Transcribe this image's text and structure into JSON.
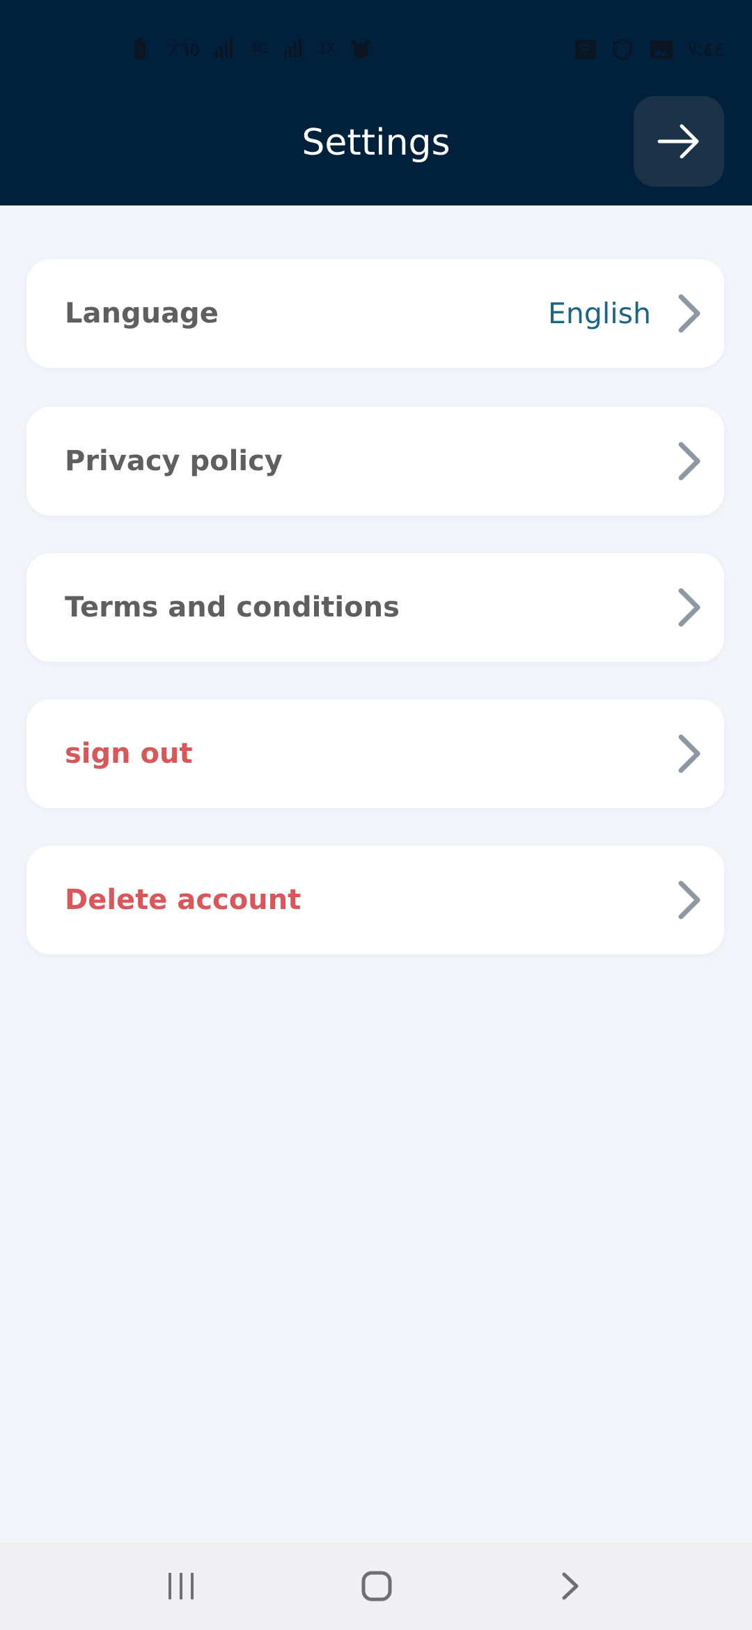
{
  "status_bar": {
    "left_text": "٪٦٥",
    "network_label": "4G",
    "speed_label": "1X",
    "time": "٧:٤٤"
  },
  "header": {
    "title": "Settings",
    "back_icon": "arrow-right-icon"
  },
  "settings": {
    "items": [
      {
        "label": "Language",
        "value": "English",
        "style": "normal",
        "icon": "chevron-right-icon"
      },
      {
        "label": "Privacy policy",
        "style": "normal",
        "icon": "chevron-right-icon"
      },
      {
        "label": "Terms and conditions",
        "style": "normal",
        "icon": "chevron-right-icon"
      },
      {
        "label": "sign out",
        "style": "danger",
        "icon": "chevron-right-icon"
      },
      {
        "label": "Delete account",
        "style": "danger",
        "icon": "chevron-right-icon"
      }
    ]
  },
  "navbar": {
    "icons": [
      "recent-apps-icon",
      "home-icon",
      "back-icon"
    ]
  },
  "colors": {
    "header_bg": "#00203c",
    "page_bg": "#f3f5fa",
    "danger": "#d9575a",
    "accent": "#1d6584",
    "label": "#5f5f5f"
  }
}
